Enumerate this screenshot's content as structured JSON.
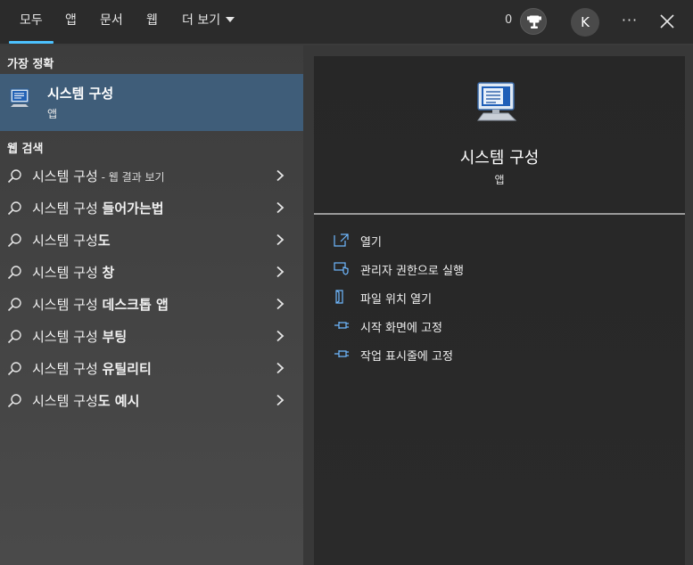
{
  "tabs": [
    {
      "label": "모두"
    },
    {
      "label": "앱"
    },
    {
      "label": "문서"
    },
    {
      "label": "웹"
    },
    {
      "label": "더 보기"
    }
  ],
  "header": {
    "points": "0",
    "avatar_initial": "K",
    "more": "···"
  },
  "left": {
    "best_match_title": "가장 정확",
    "best_match": {
      "name": "시스템 구성",
      "type": "앱"
    },
    "web_title": "웹 검색",
    "results": [
      {
        "prefix": "시스템 구성",
        "suffix": " - 웹 결과 보기"
      },
      {
        "prefix": "시스템 구성 ",
        "suffix": "들어가는법"
      },
      {
        "prefix": "시스템 구성",
        "suffix": "도"
      },
      {
        "prefix": "시스템 구성 ",
        "suffix": "창"
      },
      {
        "prefix": "시스템 구성 ",
        "suffix": "데스크톱 앱"
      },
      {
        "prefix": "시스템 구성 ",
        "suffix": "부팅"
      },
      {
        "prefix": "시스템 구성 ",
        "suffix": "유틸리티"
      },
      {
        "prefix": "시스템 구성",
        "suffix": "도 예시"
      }
    ]
  },
  "detail": {
    "title": "시스템 구성",
    "subtitle": "앱",
    "actions": [
      {
        "label": "열기",
        "icon": "open-icon"
      },
      {
        "label": "관리자 권한으로 실행",
        "icon": "shield-icon"
      },
      {
        "label": "파일 위치 열기",
        "icon": "file-location-icon"
      },
      {
        "label": "시작 화면에 고정",
        "icon": "pin-icon"
      },
      {
        "label": "작업 표시줄에 고정",
        "icon": "pin-icon"
      }
    ]
  },
  "colors": {
    "accent": "#4cc2ff",
    "selected": "#3f5d79"
  }
}
